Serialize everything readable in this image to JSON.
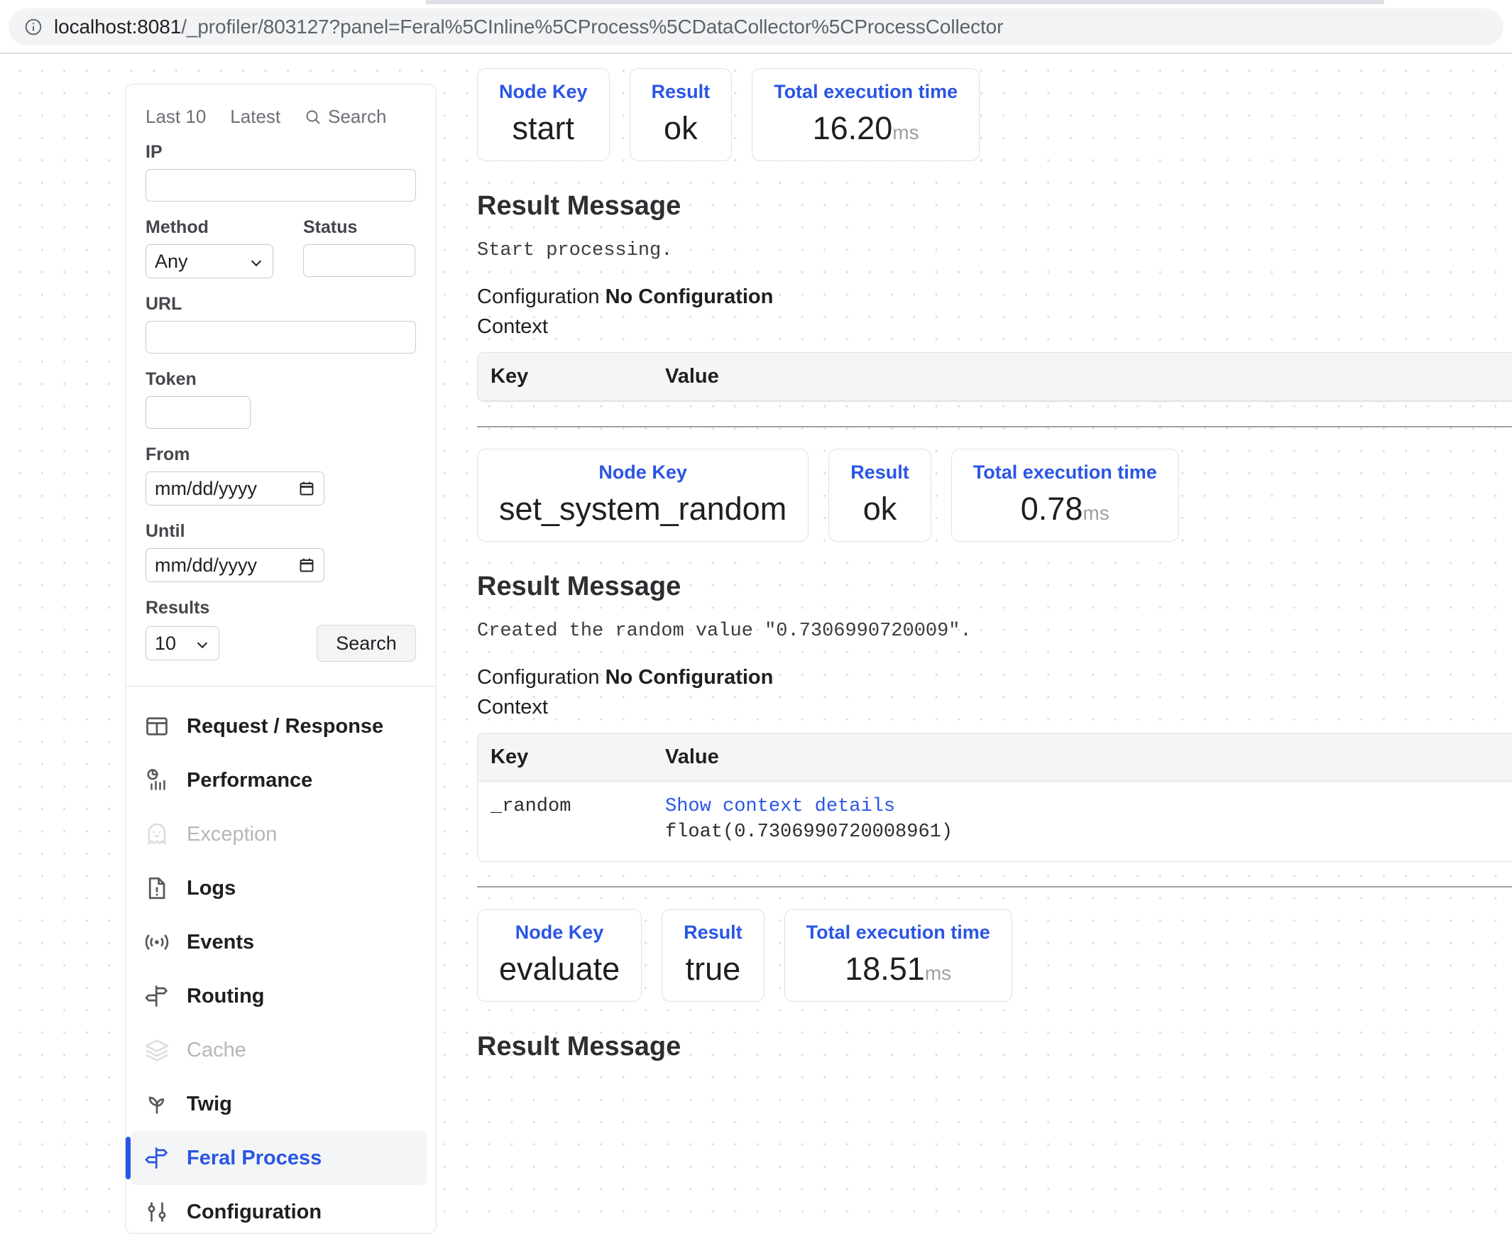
{
  "browser": {
    "url_host": "localhost:8081",
    "url_rest": "/_profiler/803127?panel=Feral%5CInline%5CProcess%5CDataCollector%5CProcessCollector",
    "info_icon": "info-circle-icon"
  },
  "sidebar": {
    "tabs": [
      {
        "label": "Last 10"
      },
      {
        "label": "Latest"
      },
      {
        "label": "Search",
        "icon": "search-icon"
      }
    ],
    "fields": {
      "ip_label": "IP",
      "ip_value": "",
      "ip_placeholder": "",
      "method_label": "Method",
      "method_value": "Any",
      "method_options": [
        "Any"
      ],
      "status_label": "Status",
      "status_value": "",
      "url_label": "URL",
      "url_value": "",
      "token_label": "Token",
      "token_value": "",
      "from_label": "From",
      "from_value": "mm/dd/yyyy",
      "until_label": "Until",
      "until_value": "mm/dd/yyyy",
      "results_label": "Results",
      "results_value": "10",
      "results_options": [
        "10"
      ],
      "search_button": "Search"
    },
    "nav": [
      {
        "label": "Request / Response",
        "icon": "browser-window-icon",
        "state": "normal"
      },
      {
        "label": "Performance",
        "icon": "pie-chart-bars-icon",
        "state": "normal"
      },
      {
        "label": "Exception",
        "icon": "ghost-icon",
        "state": "disabled"
      },
      {
        "label": "Logs",
        "icon": "document-alert-icon",
        "state": "normal"
      },
      {
        "label": "Events",
        "icon": "broadcast-icon",
        "state": "normal"
      },
      {
        "label": "Routing",
        "icon": "signpost-icon",
        "state": "normal"
      },
      {
        "label": "Cache",
        "icon": "layers-icon",
        "state": "disabled"
      },
      {
        "label": "Twig",
        "icon": "sprout-icon",
        "state": "normal"
      },
      {
        "label": "Feral Process",
        "icon": "signpost-icon",
        "state": "active"
      },
      {
        "label": "Configuration",
        "icon": "sliders-icon",
        "state": "normal"
      }
    ],
    "accent_color": "#2a55e5"
  },
  "main": {
    "card_labels": {
      "node_key": "Node Key",
      "result": "Result",
      "total_time": "Total execution time"
    },
    "table_headers": {
      "key": "Key",
      "value": "Value"
    },
    "section_title": "Result Message",
    "config_prefix": "Configuration",
    "config_value": "No Configuration",
    "context_label": "Context",
    "nodes": [
      {
        "node_key": "start",
        "result": "ok",
        "time": "16.20",
        "unit": "ms",
        "message": "Start processing.",
        "rows": []
      },
      {
        "node_key": "set_system_random",
        "result": "ok",
        "time": "0.78",
        "unit": "ms",
        "message": "Created the random value \"0.7306990720009\".",
        "rows": [
          {
            "key": "_random",
            "link": "Show context details",
            "value": "float(0.7306990720008961)"
          }
        ]
      },
      {
        "node_key": "evaluate",
        "result": "true",
        "time": "18.51",
        "unit": "ms",
        "message": "",
        "rows": []
      }
    ]
  }
}
